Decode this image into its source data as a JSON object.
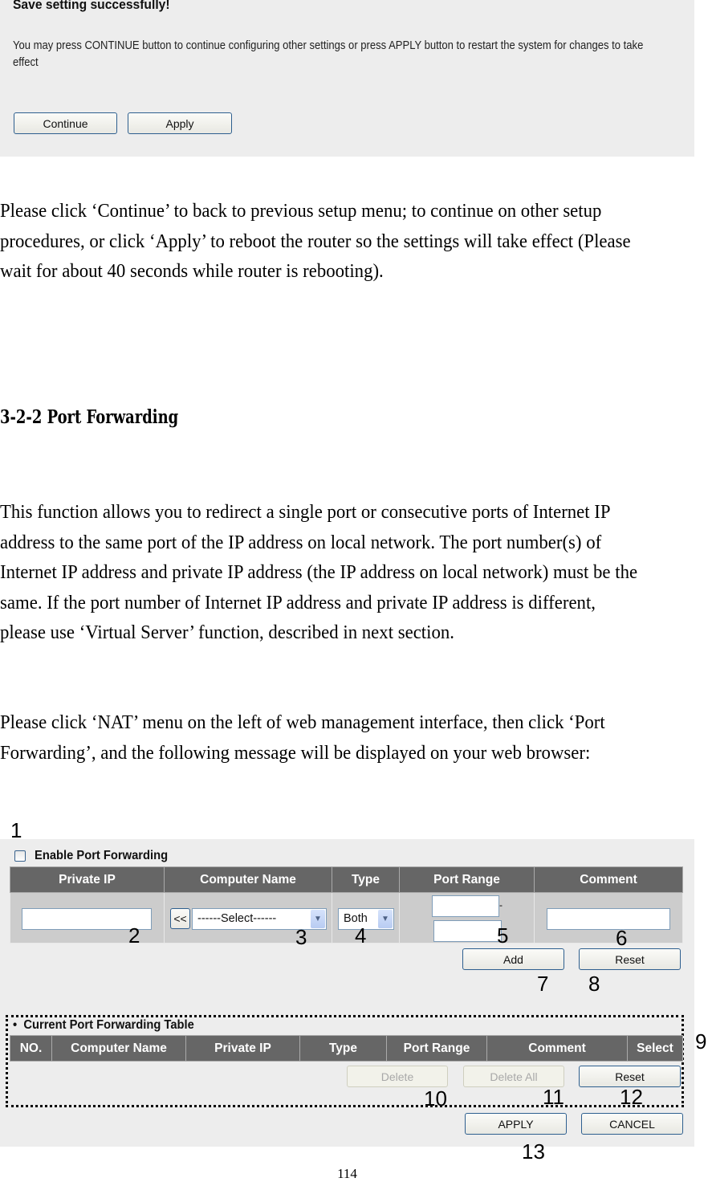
{
  "save_dialog": {
    "title": "Save setting successfully!",
    "message": "You may press CONTINUE button to continue configuring other settings or press APPLY button to restart the system for changes to take effect",
    "continue_label": "Continue",
    "apply_label": "Apply"
  },
  "paragraphs": {
    "p1": "Please click ‘Continue’ to back to previous setup menu; to continue on other setup procedures, or click ‘Apply’ to reboot the router so the settings will take effect (Please wait for about 40 seconds while router is rebooting).",
    "heading": "3-2-2 Port Forwarding",
    "p2": "This function allows you to redirect a single port or consecutive ports of Internet IP address to the same port of the IP address on local network. The port number(s) of Internet IP address and private IP address (the IP address on local network) must be the same. If the port number of Internet IP address and private IP address is different, please use ‘Virtual Server’ function, described in next section.",
    "p3": "Please click ‘NAT’ menu on the left of web management interface, then click ‘Port Forwarding’, and the following message will be displayed on your web browser:"
  },
  "port_forwarding": {
    "enable_label": "Enable Port Forwarding",
    "enable_checked": false,
    "columns": [
      "Private IP",
      "Computer Name",
      "Type",
      "Port Range",
      "Comment"
    ],
    "private_ip_value": "",
    "copy_button_label": "<<",
    "computer_name_selected": "------Select------",
    "type_selected": "Both",
    "port_start_value": "",
    "port_separator": "-",
    "port_end_value": "",
    "comment_value": "",
    "add_label": "Add",
    "reset_label": "Reset"
  },
  "current_table": {
    "title": "Current Port Forwarding Table",
    "columns": [
      "NO.",
      "Computer Name",
      "Private IP",
      "Type",
      "Port Range",
      "Comment",
      "Select"
    ],
    "rows": [],
    "delete_label": "Delete",
    "delete_all_label": "Delete All",
    "reset_label": "Reset"
  },
  "footer_buttons": {
    "apply_label": "APPLY",
    "cancel_label": "CANCEL"
  },
  "callouts": [
    "1",
    "2",
    "3",
    "4",
    "5",
    "6",
    "7",
    "8",
    "9",
    "10",
    "11",
    "12",
    "13"
  ],
  "page_number": "114"
}
